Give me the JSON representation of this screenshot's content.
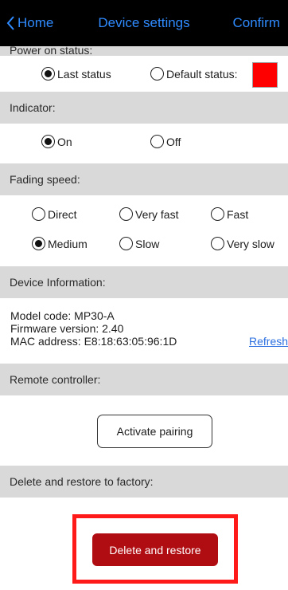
{
  "nav": {
    "back_label": "Home",
    "title": "Device settings",
    "confirm_label": "Confirm",
    "link_color": "#2f8bff"
  },
  "power_on": {
    "header": "Power on status:",
    "options": [
      {
        "label": "Last status",
        "selected": true
      },
      {
        "label": "Default status:",
        "selected": false
      }
    ],
    "default_color": "#ff0000"
  },
  "indicator": {
    "header": "Indicator:",
    "options": [
      {
        "label": "On",
        "selected": true
      },
      {
        "label": "Off",
        "selected": false
      }
    ]
  },
  "fading": {
    "header": "Fading speed:",
    "options": [
      {
        "label": "Direct",
        "selected": false
      },
      {
        "label": "Very fast",
        "selected": false
      },
      {
        "label": "Fast",
        "selected": false
      },
      {
        "label": "Medium",
        "selected": true
      },
      {
        "label": "Slow",
        "selected": false
      },
      {
        "label": "Very slow",
        "selected": false
      }
    ]
  },
  "device_info": {
    "header": "Device Information:",
    "model": "Model code: MP30-A",
    "firmware": "Firmware version: 2.40",
    "mac": "MAC address: E8:18:63:05:96:1D",
    "refresh_label": "Refresh.."
  },
  "remote": {
    "header": "Remote controller:",
    "pair_label": "Activate pairing"
  },
  "factory": {
    "header": "Delete and restore to factory:",
    "delete_label": "Delete and restore",
    "delete_color": "#b00d12",
    "highlight_color": "#ff1a1a"
  }
}
